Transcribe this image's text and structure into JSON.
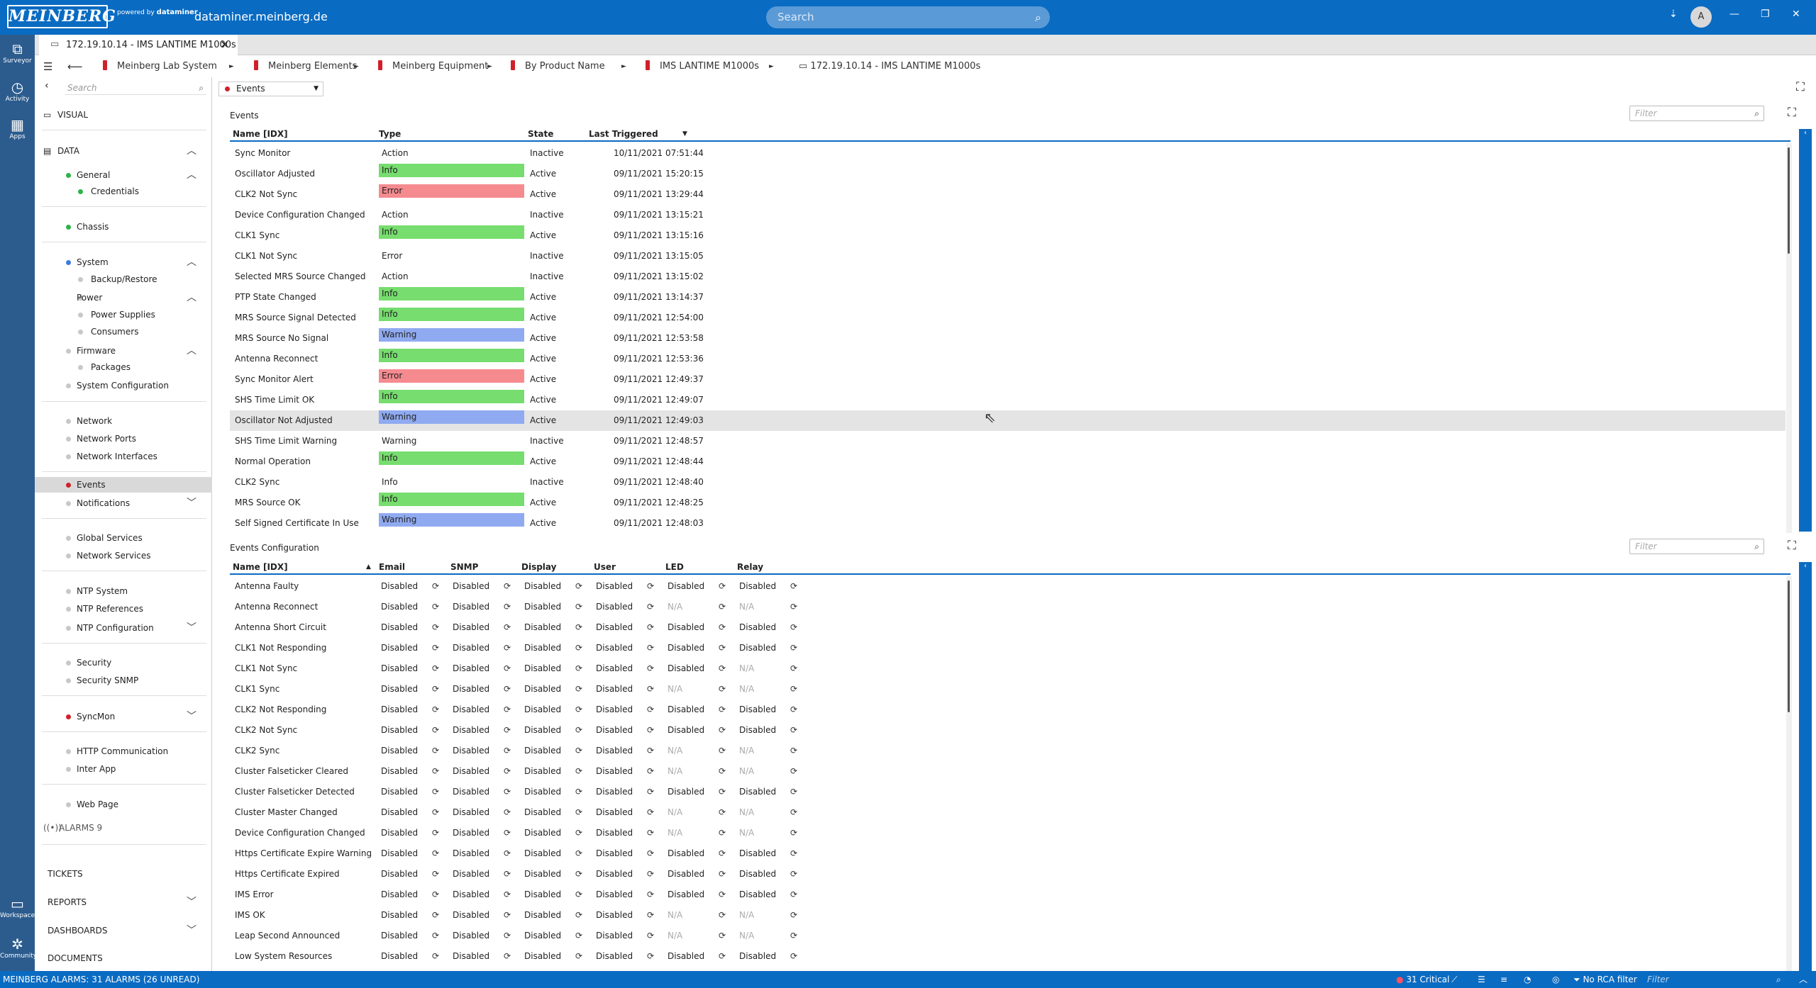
{
  "top": {
    "logo": "MEINBERG",
    "powered_by": "powered by",
    "dataminer": "dataminer",
    "host": "dataminer.meinberg.de",
    "search_placeholder": "Search",
    "avatar": "A"
  },
  "rail": [
    {
      "label": "Surveyor",
      "icon": "surveyor-icon"
    },
    {
      "label": "Activity",
      "icon": "history-icon"
    },
    {
      "label": "Apps",
      "icon": "apps-icon"
    },
    {
      "label": "Workspace",
      "icon": "workspace-icon"
    },
    {
      "label": "Community",
      "icon": "community-icon"
    }
  ],
  "tab": {
    "label": "172.19.10.14 - IMS LANTIME M1000s"
  },
  "breadcrumbs": [
    "Meinberg Lab System",
    "Meinberg Elements",
    "Meinberg Equipment",
    "By Product Name",
    "IMS LANTIME M1000s",
    "172.19.10.14 - IMS LANTIME M1000s"
  ],
  "nav": {
    "search_placeholder": "Search",
    "visual": "VISUAL",
    "data": "DATA",
    "alarms": "ALARMS 9",
    "tickets": "TICKETS",
    "reports": "REPORTS",
    "dashboards": "DASHBOARDS",
    "documents": "DOCUMENTS",
    "items": [
      "General",
      "Credentials",
      "Chassis",
      "System",
      "Backup/Restore",
      "Power",
      "Power Supplies",
      "Consumers",
      "Firmware",
      "Packages",
      "System Configuration",
      "Network",
      "Network Ports",
      "Network Interfaces",
      "Events",
      "Notifications",
      "Global Services",
      "Network Services",
      "NTP System",
      "NTP References",
      "NTP Configuration",
      "Security",
      "Security SNMP",
      "SyncMon",
      "HTTP Communication",
      "Inter App",
      "Web Page"
    ]
  },
  "page_selector": "Events",
  "events": {
    "title": "Events",
    "filter_placeholder": "Filter",
    "columns": [
      "Name [IDX]",
      "Type",
      "State",
      "Last Triggered"
    ],
    "rows": [
      [
        "Sync Monitor",
        "Action",
        "Inactive",
        "10/11/2021 07:51:44"
      ],
      [
        "Oscillator Adjusted",
        "Info",
        "Active",
        "09/11/2021 15:20:15"
      ],
      [
        "CLK2 Not Sync",
        "Error",
        "Active",
        "09/11/2021 13:29:44"
      ],
      [
        "Device Configuration Changed",
        "Action",
        "Inactive",
        "09/11/2021 13:15:21"
      ],
      [
        "CLK1 Sync",
        "Info",
        "Active",
        "09/11/2021 13:15:16"
      ],
      [
        "CLK1 Not Sync",
        "Error",
        "Inactive",
        "09/11/2021 13:15:05"
      ],
      [
        "Selected MRS Source Changed",
        "Action",
        "Inactive",
        "09/11/2021 13:15:02"
      ],
      [
        "PTP State Changed",
        "Info",
        "Active",
        "09/11/2021 13:14:37"
      ],
      [
        "MRS Source Signal Detected",
        "Info",
        "Active",
        "09/11/2021 12:54:00"
      ],
      [
        "MRS Source No Signal",
        "Warning",
        "Active",
        "09/11/2021 12:53:58"
      ],
      [
        "Antenna Reconnect",
        "Info",
        "Active",
        "09/11/2021 12:53:36"
      ],
      [
        "Sync Monitor Alert",
        "Error",
        "Active",
        "09/11/2021 12:49:37"
      ],
      [
        "SHS Time Limit OK",
        "Info",
        "Active",
        "09/11/2021 12:49:07"
      ],
      [
        "Oscillator Not Adjusted",
        "Warning",
        "Active",
        "09/11/2021 12:49:03"
      ],
      [
        "SHS Time Limit Warning",
        "Warning",
        "Inactive",
        "09/11/2021 12:48:57"
      ],
      [
        "Normal Operation",
        "Info",
        "Active",
        "09/11/2021 12:48:44"
      ],
      [
        "CLK2 Sync",
        "Info",
        "Inactive",
        "09/11/2021 12:48:40"
      ],
      [
        "MRS Source OK",
        "Info",
        "Active",
        "09/11/2021 12:48:25"
      ],
      [
        "Self Signed Certificate In Use",
        "Warning",
        "Active",
        "09/11/2021 12:48:03"
      ]
    ]
  },
  "config": {
    "title": "Events Configuration",
    "filter_placeholder": "Filter",
    "columns": [
      "Name [IDX]",
      "Email",
      "SNMP",
      "Display",
      "User",
      "LED",
      "Relay"
    ],
    "rows": [
      [
        "Antenna Faulty",
        "Disabled",
        "Disabled",
        "Disabled",
        "Disabled",
        "Disabled",
        "Disabled"
      ],
      [
        "Antenna Reconnect",
        "Disabled",
        "Disabled",
        "Disabled",
        "Disabled",
        "N/A",
        "N/A"
      ],
      [
        "Antenna Short Circuit",
        "Disabled",
        "Disabled",
        "Disabled",
        "Disabled",
        "Disabled",
        "Disabled"
      ],
      [
        "CLK1 Not Responding",
        "Disabled",
        "Disabled",
        "Disabled",
        "Disabled",
        "Disabled",
        "Disabled"
      ],
      [
        "CLK1 Not Sync",
        "Disabled",
        "Disabled",
        "Disabled",
        "Disabled",
        "Disabled",
        "N/A"
      ],
      [
        "CLK1 Sync",
        "Disabled",
        "Disabled",
        "Disabled",
        "Disabled",
        "N/A",
        "N/A"
      ],
      [
        "CLK2 Not Responding",
        "Disabled",
        "Disabled",
        "Disabled",
        "Disabled",
        "Disabled",
        "Disabled"
      ],
      [
        "CLK2 Not Sync",
        "Disabled",
        "Disabled",
        "Disabled",
        "Disabled",
        "Disabled",
        "Disabled"
      ],
      [
        "CLK2 Sync",
        "Disabled",
        "Disabled",
        "Disabled",
        "Disabled",
        "N/A",
        "N/A"
      ],
      [
        "Cluster Falseticker Cleared",
        "Disabled",
        "Disabled",
        "Disabled",
        "Disabled",
        "N/A",
        "N/A"
      ],
      [
        "Cluster Falseticker Detected",
        "Disabled",
        "Disabled",
        "Disabled",
        "Disabled",
        "Disabled",
        "Disabled"
      ],
      [
        "Cluster Master Changed",
        "Disabled",
        "Disabled",
        "Disabled",
        "Disabled",
        "N/A",
        "N/A"
      ],
      [
        "Device Configuration Changed",
        "Disabled",
        "Disabled",
        "Disabled",
        "Disabled",
        "N/A",
        "N/A"
      ],
      [
        "Https Certificate Expire Warning",
        "Disabled",
        "Disabled",
        "Disabled",
        "Disabled",
        "Disabled",
        "Disabled"
      ],
      [
        "Https Certificate Expired",
        "Disabled",
        "Disabled",
        "Disabled",
        "Disabled",
        "Disabled",
        "Disabled"
      ],
      [
        "IMS Error",
        "Disabled",
        "Disabled",
        "Disabled",
        "Disabled",
        "Disabled",
        "Disabled"
      ],
      [
        "IMS OK",
        "Disabled",
        "Disabled",
        "Disabled",
        "Disabled",
        "N/A",
        "N/A"
      ],
      [
        "Leap Second Announced",
        "Disabled",
        "Disabled",
        "Disabled",
        "Disabled",
        "N/A",
        "N/A"
      ],
      [
        "Low System Resources",
        "Disabled",
        "Disabled",
        "Disabled",
        "Disabled",
        "Disabled",
        "Disabled"
      ]
    ]
  },
  "status": {
    "alarms": "MEINBERG ALARMS: 31 ALARMS (26 UNREAD)",
    "critical": "31 Critical",
    "rca": "No RCA filter",
    "filter_placeholder": "Filter"
  },
  "colors": {
    "info": "#76dd6e",
    "error": "#f58a8f",
    "warning": "#8faaf0",
    "brand": "#0a6bc2"
  }
}
